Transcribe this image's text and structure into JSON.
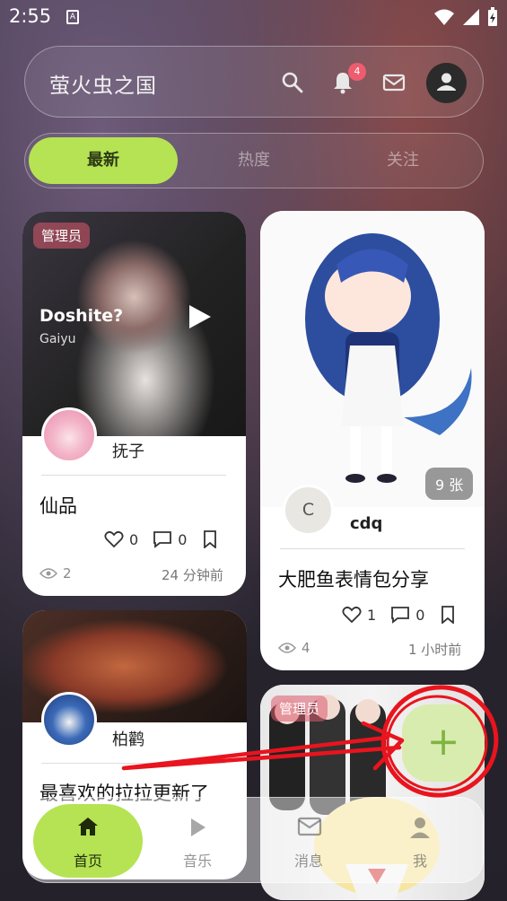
{
  "status_bar": {
    "time": "2:55",
    "notif_glyph": "A"
  },
  "header": {
    "title": "萤火虫之国",
    "notification_count": "4"
  },
  "tabs": [
    {
      "label": "最新",
      "active": true
    },
    {
      "label": "热度",
      "active": false
    },
    {
      "label": "关注",
      "active": false
    }
  ],
  "posts": [
    {
      "admin_tag": "管理员",
      "song_title": "Doshite?",
      "song_artist": "Gaiyu",
      "username": "抚子",
      "title": "仙品",
      "likes": "0",
      "comments": "0",
      "views": "2",
      "time": "24 分钟前"
    },
    {
      "image_count": "9 张",
      "avatar_letter": "C",
      "username": "cdq",
      "title": "大肥鱼表情包分享",
      "likes": "1",
      "comments": "0",
      "views": "4",
      "time": "1 小时前"
    },
    {
      "username": "柏鹳",
      "title": "最喜欢的拉拉更新了"
    },
    {
      "admin_tag": "管理员"
    }
  ],
  "fab": {
    "label": "+"
  },
  "bottom_nav": [
    {
      "label": "首页",
      "active": true
    },
    {
      "label": "音乐",
      "active": false
    },
    {
      "label": "消息",
      "active": false
    },
    {
      "label": "我",
      "active": false
    }
  ],
  "colors": {
    "accent": "#b5e353",
    "badge": "#ef5c6e",
    "annotation": "#e8141e"
  }
}
